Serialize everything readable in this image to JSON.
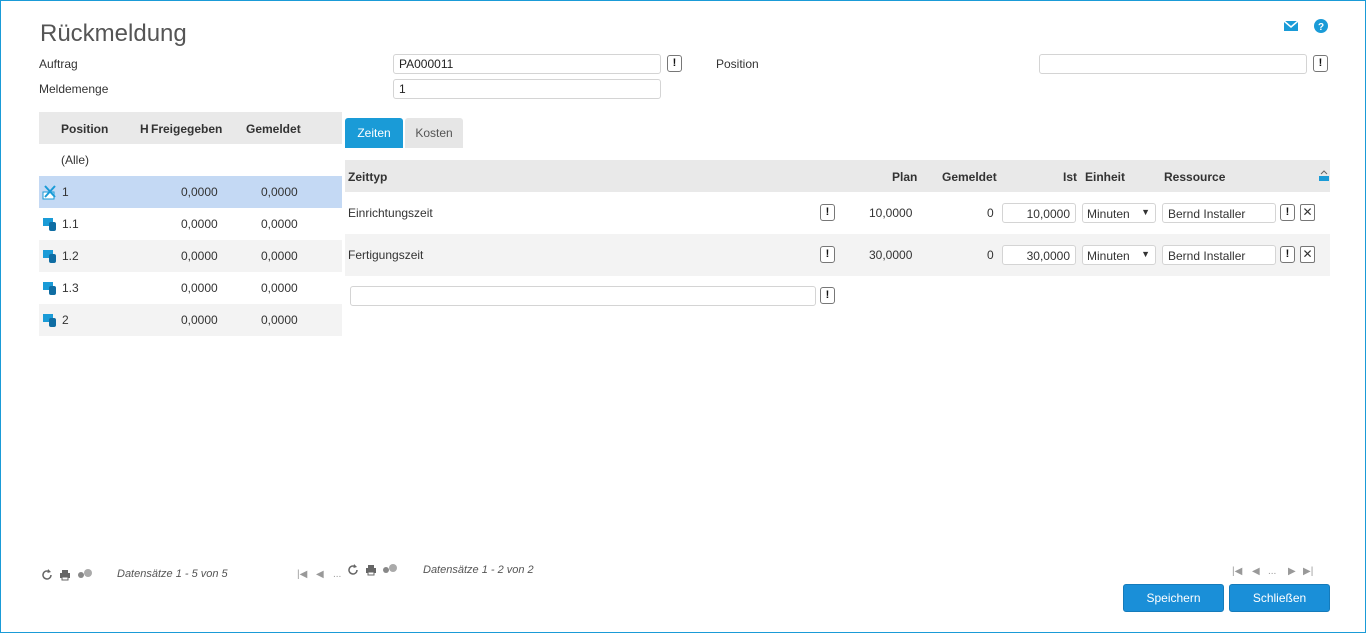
{
  "page": {
    "title": "Rückmeldung"
  },
  "form": {
    "auftrag_label": "Auftrag",
    "auftrag_value": "PA000011",
    "position_label": "Position",
    "position_value": "",
    "meldemenge_label": "Meldemenge",
    "meldemenge_value": "1"
  },
  "left_grid": {
    "headers": {
      "position": "Position",
      "h": "H",
      "freigegeben": "Freigegeben",
      "gemeldet": "Gemeldet"
    },
    "all_label": "(Alle)",
    "rows": [
      {
        "position": "1",
        "freigegeben": "0,0000",
        "gemeldet": "0,0000",
        "icon": "tools-icon"
      },
      {
        "position": "1.1",
        "freigegeben": "0,0000",
        "gemeldet": "0,0000",
        "icon": "operation-icon"
      },
      {
        "position": "1.2",
        "freigegeben": "0,0000",
        "gemeldet": "0,0000",
        "icon": "operation-icon"
      },
      {
        "position": "1.3",
        "freigegeben": "0,0000",
        "gemeldet": "0,0000",
        "icon": "operation-icon"
      },
      {
        "position": "2",
        "freigegeben": "0,0000",
        "gemeldet": "0,0000",
        "icon": "operation-icon"
      }
    ],
    "footer": "Datensätze 1 - 5 von 5",
    "pager_ellipsis": "..."
  },
  "tabs": [
    {
      "label": "Zeiten",
      "active": true
    },
    {
      "label": "Kosten",
      "active": false
    }
  ],
  "right_grid": {
    "headers": {
      "zeittyp": "Zeittyp",
      "plan": "Plan",
      "gemeldet": "Gemeldet",
      "ist": "Ist",
      "einheit": "Einheit",
      "ressource": "Ressource"
    },
    "rows": [
      {
        "zeittyp": "Einrichtungszeit",
        "plan": "10,0000",
        "gemeldet": "0",
        "ist": "10,0000",
        "einheit": "Minuten",
        "ressource": "Bernd Installer"
      },
      {
        "zeittyp": "Fertigungszeit",
        "plan": "30,0000",
        "gemeldet": "0",
        "ist": "30,0000",
        "einheit": "Minuten",
        "ressource": "Bernd Installer"
      }
    ],
    "new_row_value": "",
    "footer": "Datensätze 1 - 2 von 2",
    "pager_ellipsis": "..."
  },
  "buttons": {
    "save": "Speichern",
    "close": "Schließen"
  },
  "colors": {
    "accent": "#1a9bd7",
    "selected_row": "#c4d9f4",
    "header_bg": "#e9e9e9"
  }
}
